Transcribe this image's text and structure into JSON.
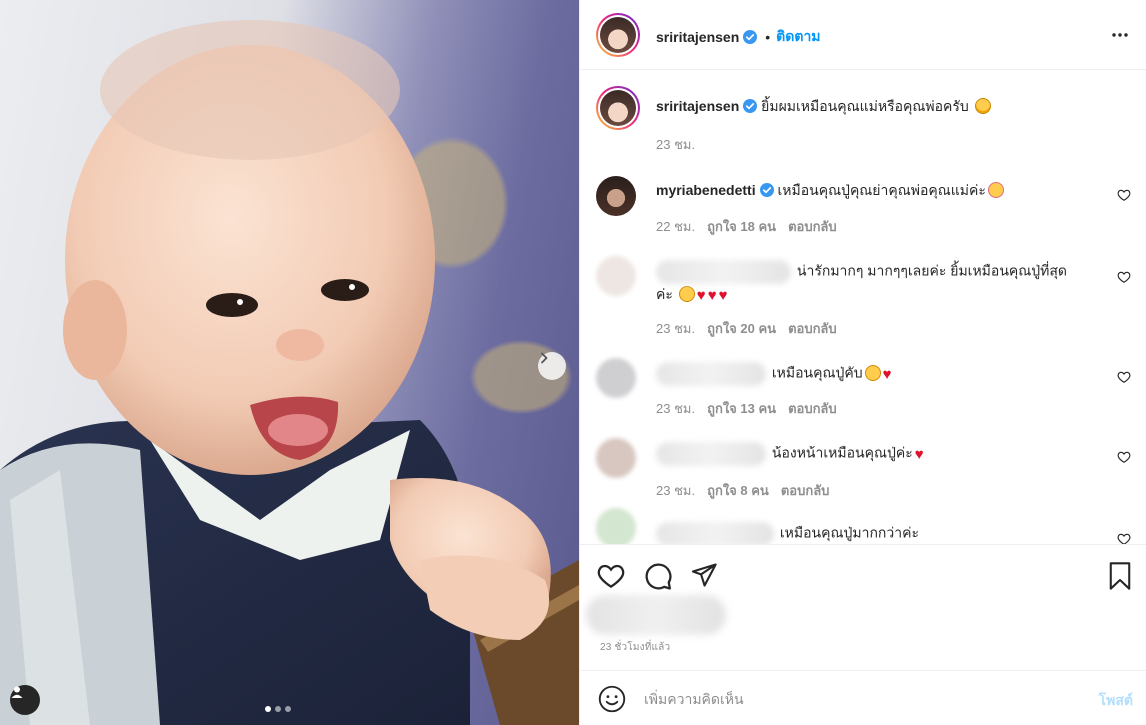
{
  "post": {
    "author": "sriritajensen",
    "follow_label": "ติดตาม",
    "separator": "•",
    "caption": "ยิ้มผมเหมือนคุณแม่หรือคุณพ่อครับ",
    "caption_time": "23 ชม.",
    "post_time": "23 ชั่วโมงที่แล้ว",
    "carousel_index": 1,
    "carousel_count": 3
  },
  "comments": [
    {
      "username": "myriabenedetti",
      "verified": true,
      "text": "เหมือนคุณปู่คุณย่าคุณพ่อคุณแม่ค่ะ",
      "time": "22 ชม.",
      "likes": "ถูกใจ 18 คน",
      "reply": "ตอบกลับ"
    },
    {
      "username_hidden": true,
      "text": "น่ารักมากๆ มากๆๆเลยค่ะ ยิ้มเหมือนคุณปู่ที่สุด",
      "text_line2": "ค่ะ",
      "time": "23 ชม.",
      "likes": "ถูกใจ 20 คน",
      "reply": "ตอบกลับ"
    },
    {
      "username_hidden": true,
      "text": "เหมือนคุณปู่คับ",
      "time": "23 ชม.",
      "likes": "ถูกใจ 13 คน",
      "reply": "ตอบกลับ"
    },
    {
      "username_hidden": true,
      "text": "น้องหน้าเหมือนคุณปู่ค่ะ",
      "time": "23 ชม.",
      "likes": "ถูกใจ 8 คน",
      "reply": "ตอบกลับ"
    },
    {
      "username_hidden": true,
      "text": "เหมือนคุณปู่มากกว่าค่ะ"
    }
  ],
  "add_comment": {
    "placeholder": "เพิ่มความคิดเห็น",
    "post_label": "โพสต์"
  },
  "colors": {
    "accent": "#0095f6",
    "verified": "#3897f0",
    "post_disabled": "#b2dffc",
    "muted_text": "#8e8e8e"
  },
  "icons": {
    "like": "heart-icon",
    "comment": "comment-icon",
    "share": "paper-plane-icon",
    "save": "bookmark-icon",
    "more": "more-options-icon",
    "emoji": "emoji-icon",
    "next": "chevron-right-icon",
    "tag": "user-tag-icon"
  }
}
